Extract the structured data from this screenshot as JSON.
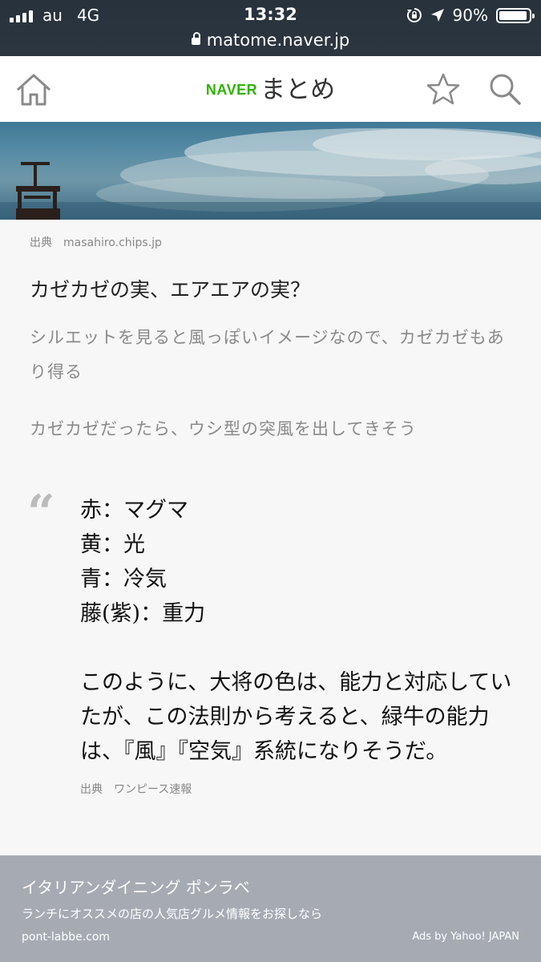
{
  "status_bar": {
    "carrier": "au",
    "network": "4G",
    "time": "13:32",
    "battery": "90%",
    "battery_level": 0.9,
    "url": "matome.naver.jp"
  },
  "header": {
    "brand_naver": "NAVER",
    "brand_matome": "まとめ",
    "home_icon": "home-icon",
    "favorite_icon": "star-icon",
    "search_icon": "search-icon",
    "brand_color": "#2db400"
  },
  "image_source": {
    "label": "出典",
    "url": "masahiro.chips.jp"
  },
  "article": {
    "heading": "カゼカゼの実、エアエアの実？",
    "paragraph1": "シルエットを見ると風っぽいイメージなので、カゼカゼもあり得る",
    "paragraph2": "カゼカゼだったら、ウシ型の突風を出してきそう"
  },
  "quote": {
    "mark": "“",
    "lines": [
      "赤：マグマ",
      "黄：光",
      "青：冷気",
      "藤(紫)：重力"
    ],
    "paragraph": "このように、大将の色は、能力と対応していたが、この法則から考えると、緑牛の能力は、『風』『空気』系統になりそうだ。",
    "source_label": "出典",
    "source_name": "ワンピース速報"
  },
  "ad": {
    "title": "イタリアンダイニング ポンラベ",
    "text": "ランチにオススメの店の人気店グルメ情報をお探しなら",
    "url": "pont-labbe.com",
    "provider": "Ads by Yahoo! JAPAN"
  }
}
